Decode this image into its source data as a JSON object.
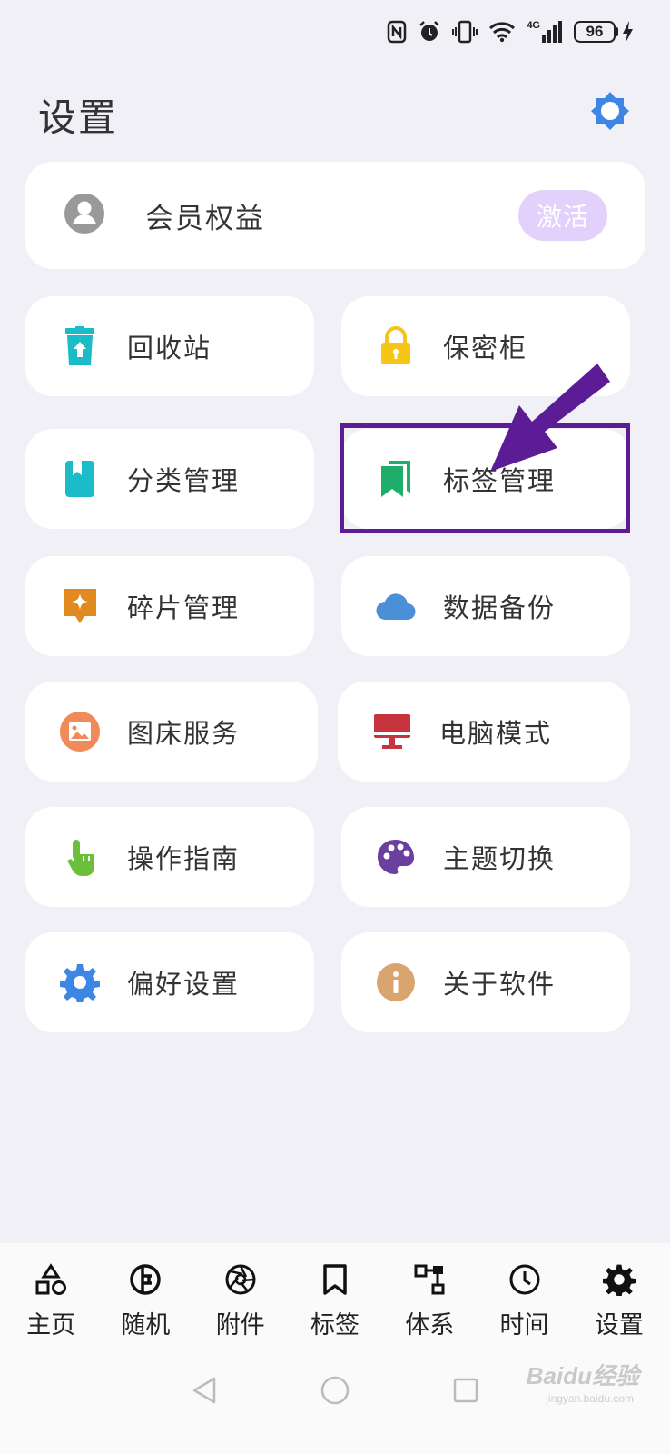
{
  "status_bar": {
    "icons": [
      "nfc-icon",
      "alarm-icon",
      "vibrate-icon",
      "wifi-icon",
      "signal-4g-icon"
    ],
    "network_label": "4G",
    "battery": "96"
  },
  "header": {
    "title": "设置",
    "theme_icon": "theme-toggle-icon"
  },
  "member": {
    "label": "会员权益",
    "button": "激活",
    "icon": "user-avatar-icon"
  },
  "tiles": [
    {
      "label": "回收站",
      "icon": "recycle-bin-icon",
      "color": "#1bbcc7"
    },
    {
      "label": "保密柜",
      "icon": "lock-icon",
      "color": "#f7c513"
    },
    {
      "label": "分类管理",
      "icon": "book-icon",
      "color": "#1bbcc7"
    },
    {
      "label": "标签管理",
      "icon": "bookmark-stack-icon",
      "color": "#1fae6a"
    },
    {
      "label": "碎片管理",
      "icon": "sparkle-icon",
      "color": "#e08a1f"
    },
    {
      "label": "数据备份",
      "icon": "cloud-icon",
      "color": "#4b8fd6"
    },
    {
      "label": "图床服务",
      "icon": "image-icon",
      "color": "#f08a5a"
    },
    {
      "label": "电脑模式",
      "icon": "desktop-icon",
      "color": "#c8343d"
    },
    {
      "label": "操作指南",
      "icon": "tap-hand-icon",
      "color": "#6cbf3b"
    },
    {
      "label": "主题切换",
      "icon": "palette-icon",
      "color": "#6b3fa0"
    },
    {
      "label": "偏好设置",
      "icon": "gear-icon",
      "color": "#3e86e6"
    },
    {
      "label": "关于软件",
      "icon": "info-icon",
      "color": "#d9a46e"
    }
  ],
  "bottom_nav": [
    {
      "label": "主页",
      "icon": "shapes-icon"
    },
    {
      "label": "随机",
      "icon": "random-icon"
    },
    {
      "label": "附件",
      "icon": "aperture-icon"
    },
    {
      "label": "标签",
      "icon": "bookmark-icon"
    },
    {
      "label": "体系",
      "icon": "hierarchy-icon"
    },
    {
      "label": "时间",
      "icon": "clock-icon"
    },
    {
      "label": "设置",
      "icon": "gear-icon"
    }
  ],
  "watermark": {
    "brand": "Baidu经验",
    "url": "jingyan.baidu.com"
  },
  "colors": {
    "highlight": "#5b1c96",
    "activate_bg": "#e2d2fb",
    "theme_icon": "#3e86e6"
  }
}
